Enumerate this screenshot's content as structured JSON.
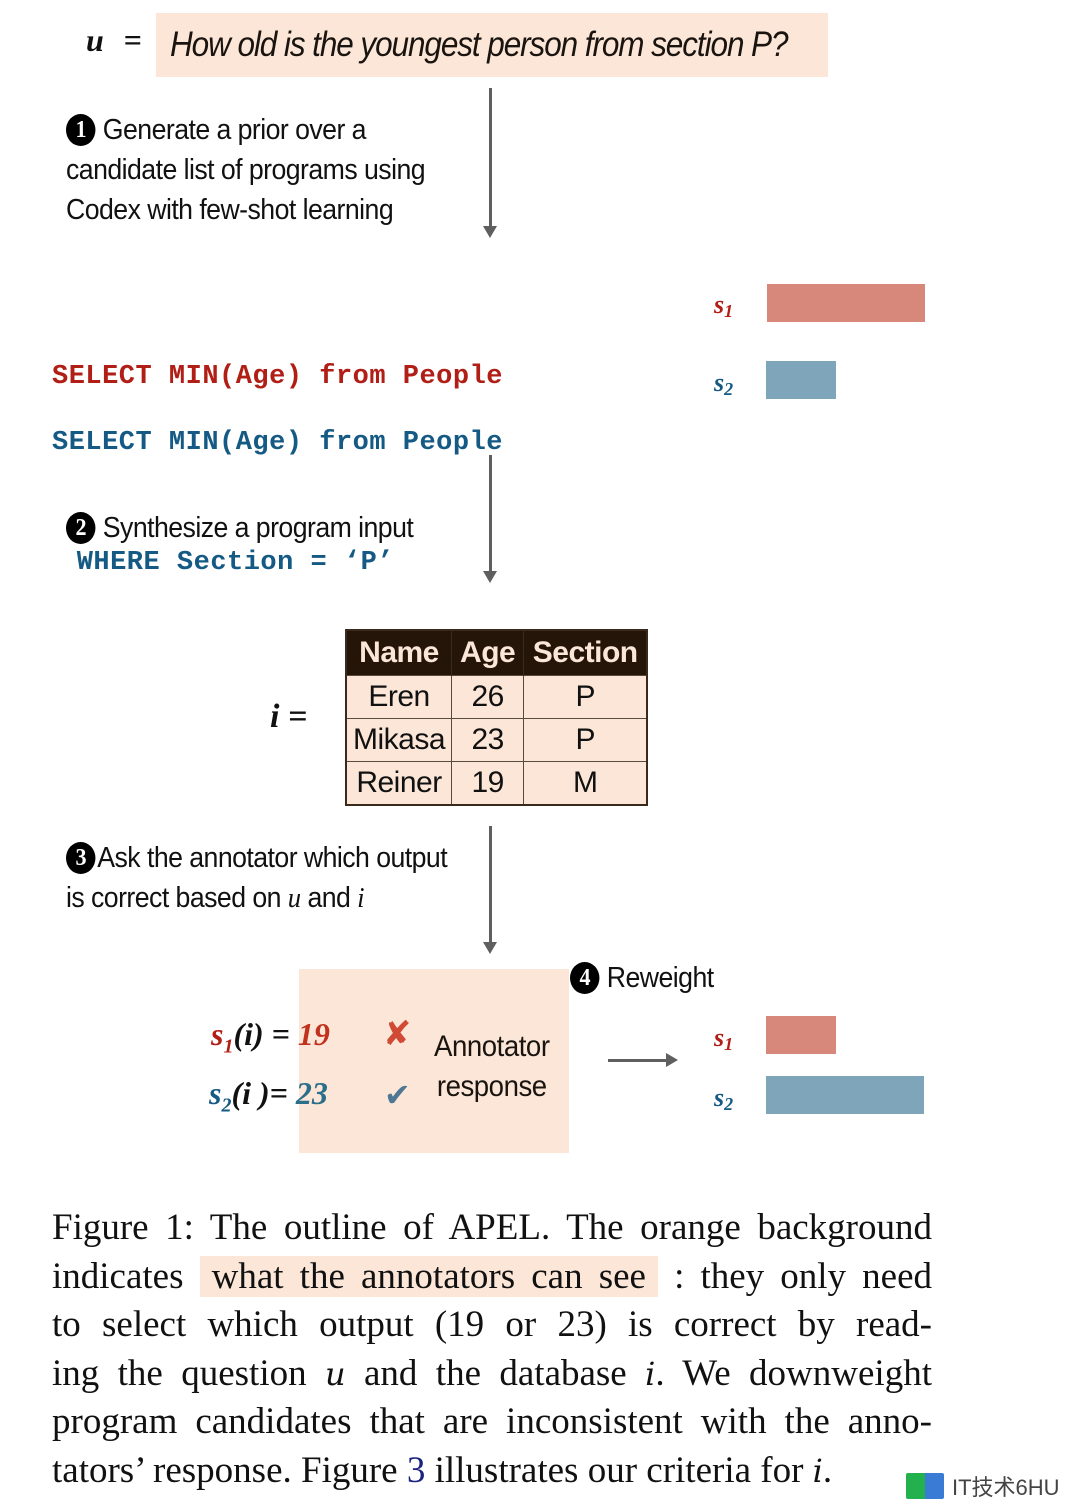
{
  "question": {
    "var_label": "u",
    "equals": "=",
    "text": "How old is the youngest person from section P?"
  },
  "steps": [
    {
      "number": "1",
      "lines": [
        "Generate a prior over a",
        "candidate list of programs using",
        "Codex with few-shot learning"
      ]
    },
    {
      "number": "2",
      "lines": [
        "Synthesize a program input"
      ]
    },
    {
      "number": "3",
      "line1": "Ask the annotator which output",
      "line2_prefix": "is correct based on ",
      "var_u": "u",
      "and": " and ",
      "var_i": "i"
    },
    {
      "number": "4",
      "lines": [
        "Reweight"
      ]
    }
  ],
  "programs": [
    {
      "id": "s1",
      "lines": [
        "SELECT MIN(Age) from People"
      ],
      "color": "#b01e16"
    },
    {
      "id": "s2",
      "lines": [
        "SELECT MIN(Age) from People",
        " WHERE Section = ‘P’"
      ],
      "color": "#155a84"
    }
  ],
  "prior_weights": {
    "s1": {
      "label": "s",
      "sub": "1",
      "relative_weight": 1.0
    },
    "s2": {
      "label": "s",
      "sub": "2",
      "relative_weight": 0.44
    }
  },
  "input": {
    "var_label": "i =",
    "table": {
      "columns": [
        "Name",
        "Age",
        "Section"
      ],
      "rows": [
        [
          "Eren",
          "26",
          "P"
        ],
        [
          "Mikasa",
          "23",
          "P"
        ],
        [
          "Reiner",
          "19",
          "M"
        ]
      ]
    }
  },
  "outputs": [
    {
      "lhs_s": "s",
      "lhs_sub": "1",
      "lhs_rest": "(i) = ",
      "value": "19",
      "verdict": "wrong",
      "verdict_icon": "✘"
    },
    {
      "lhs_s": "s",
      "lhs_sub": "2",
      "lhs_rest": "(i )= ",
      "value": "23",
      "verdict": "correct",
      "verdict_icon": "✔"
    }
  ],
  "annotator_label": [
    "Annotator",
    "response"
  ],
  "posterior_weights": {
    "s1": {
      "label": "s",
      "sub": "1",
      "relative_weight": 0.44
    },
    "s2": {
      "label": "s",
      "sub": "2",
      "relative_weight": 1.0
    }
  },
  "colors": {
    "peach": "#fbe6d7",
    "red": "#b01e16",
    "blue": "#155a84",
    "bar_red": "#d8887b",
    "bar_blue": "#7fa5bb",
    "arrow": "#5f5f5f"
  },
  "caption": {
    "line1": "Figure 1: The outline of APEL. The orange background",
    "line2_pre": "indicates",
    "line2_hl": "what the annotators can see",
    "line2_post": ": they only need",
    "line3": "to select which output (19 or 23) is correct by read-",
    "line4_pre": "ing the question ",
    "line4_u": "u",
    "line4_mid": " and the database ",
    "line4_i": "i",
    "line4_post": ". We downweight",
    "line5": "program candidates that are inconsistent with the anno-",
    "line6_pre": "tators’ response. Figure ",
    "line6_ref": "3",
    "line6_mid": " illustrates our criteria for ",
    "line6_i": "i",
    "line6_post": "."
  },
  "watermark": {
    "text": "IT技术6HU"
  }
}
